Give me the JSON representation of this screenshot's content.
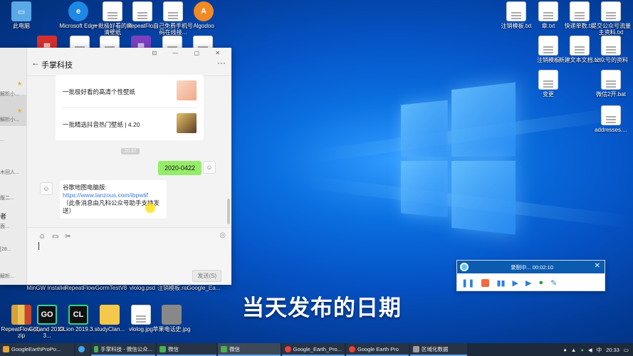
{
  "desktop": {
    "icons_left": [
      {
        "label": "此电脑",
        "kind": "pc"
      },
      {
        "label": "Microsoft Edge",
        "kind": "edge"
      },
      {
        "label": "一批极好看的高清壁纸",
        "kind": "doc"
      },
      {
        "label": "RepeatFlo...",
        "kind": "doc"
      },
      {
        "label": "自己免费手机号码在线接...",
        "kind": "doc"
      },
      {
        "label": "Algodoo",
        "kind": "algodoo"
      }
    ],
    "icons_bottom": [
      {
        "label": "RepeatFlow (2).zip",
        "kind": "zip"
      },
      {
        "label": "GoLand 2019.3...",
        "kind": "goland"
      },
      {
        "label": "CLion 2019.3...",
        "kind": "clion"
      },
      {
        "label": "studyClan...",
        "kind": "doc"
      },
      {
        "label": "vlolog.jpg",
        "kind": "img"
      },
      {
        "label": "苹果电话史.jpg",
        "kind": "img"
      }
    ],
    "icons_bottom_row_above": [
      "MinGW Installer",
      "RepeatFlow",
      "GormTestV8",
      "vlolog.psd",
      "注销模板.rar",
      "Google_Ea..."
    ],
    "icons_right": [
      {
        "label": "注销模板.txt"
      },
      {
        "label": "章.txt"
      },
      {
        "label": "快递单数.txt"
      },
      {
        "label": "提交公众号流量主资料.txt"
      },
      {
        "label": "注销模板"
      },
      {
        "label": "新建文本文档.txt"
      },
      {
        "label": "公众号的资料"
      },
      {
        "label": "变更"
      },
      {
        "label": "微信2开.bat"
      },
      {
        "label": "addresses...."
      }
    ]
  },
  "chat": {
    "title": "手掌科技",
    "back_icon": "back-arrow-icon",
    "more_icon": "more-icon",
    "window_controls": "⊡ — ▢ ✕",
    "sidebar_rows": [
      "解析小...",
      "解析小...",
      "...",
      "木回人...",
      "版二...",
      "者",
      "面...",
      "[28...",
      "解析..."
    ],
    "card_items": [
      {
        "text": "一批极好看的高清个性壁纸"
      },
      {
        "text": "一批精选抖音热门壁纸 | 4.20"
      }
    ],
    "timestamp": "20:37",
    "sent_message": "2020-0422",
    "received": {
      "line1": "谷歌地图电脑版: ",
      "link": "https://www.lanzous.com/ibpwtif",
      "line2": "（此条消息由凡科公众号助手支持发送）"
    },
    "send_label": "发送(S)"
  },
  "recorder": {
    "status": "录制中... 00:02:10",
    "close": "✕"
  },
  "caption": "当天发布的日期",
  "taskbar": {
    "items": [
      {
        "label": "GoogleEarthProPo...",
        "color": "#e8a33a"
      },
      {
        "label": "",
        "color": "#3fa9f5"
      },
      {
        "label": "手掌科技 - 微信公众...",
        "color": "#4caf50"
      },
      {
        "label": "微信",
        "color": "#4caf50"
      },
      {
        "label": "微信",
        "color": "#4caf50"
      },
      {
        "label": "Google_Earth_Pro...",
        "color": "#ea4335"
      },
      {
        "label": "Google Earth Pro",
        "color": "#ea4335"
      },
      {
        "label": "区域化数据",
        "color": "#9e9e9e"
      }
    ],
    "tray": {
      "ime": "中",
      "time": "20:33"
    }
  }
}
